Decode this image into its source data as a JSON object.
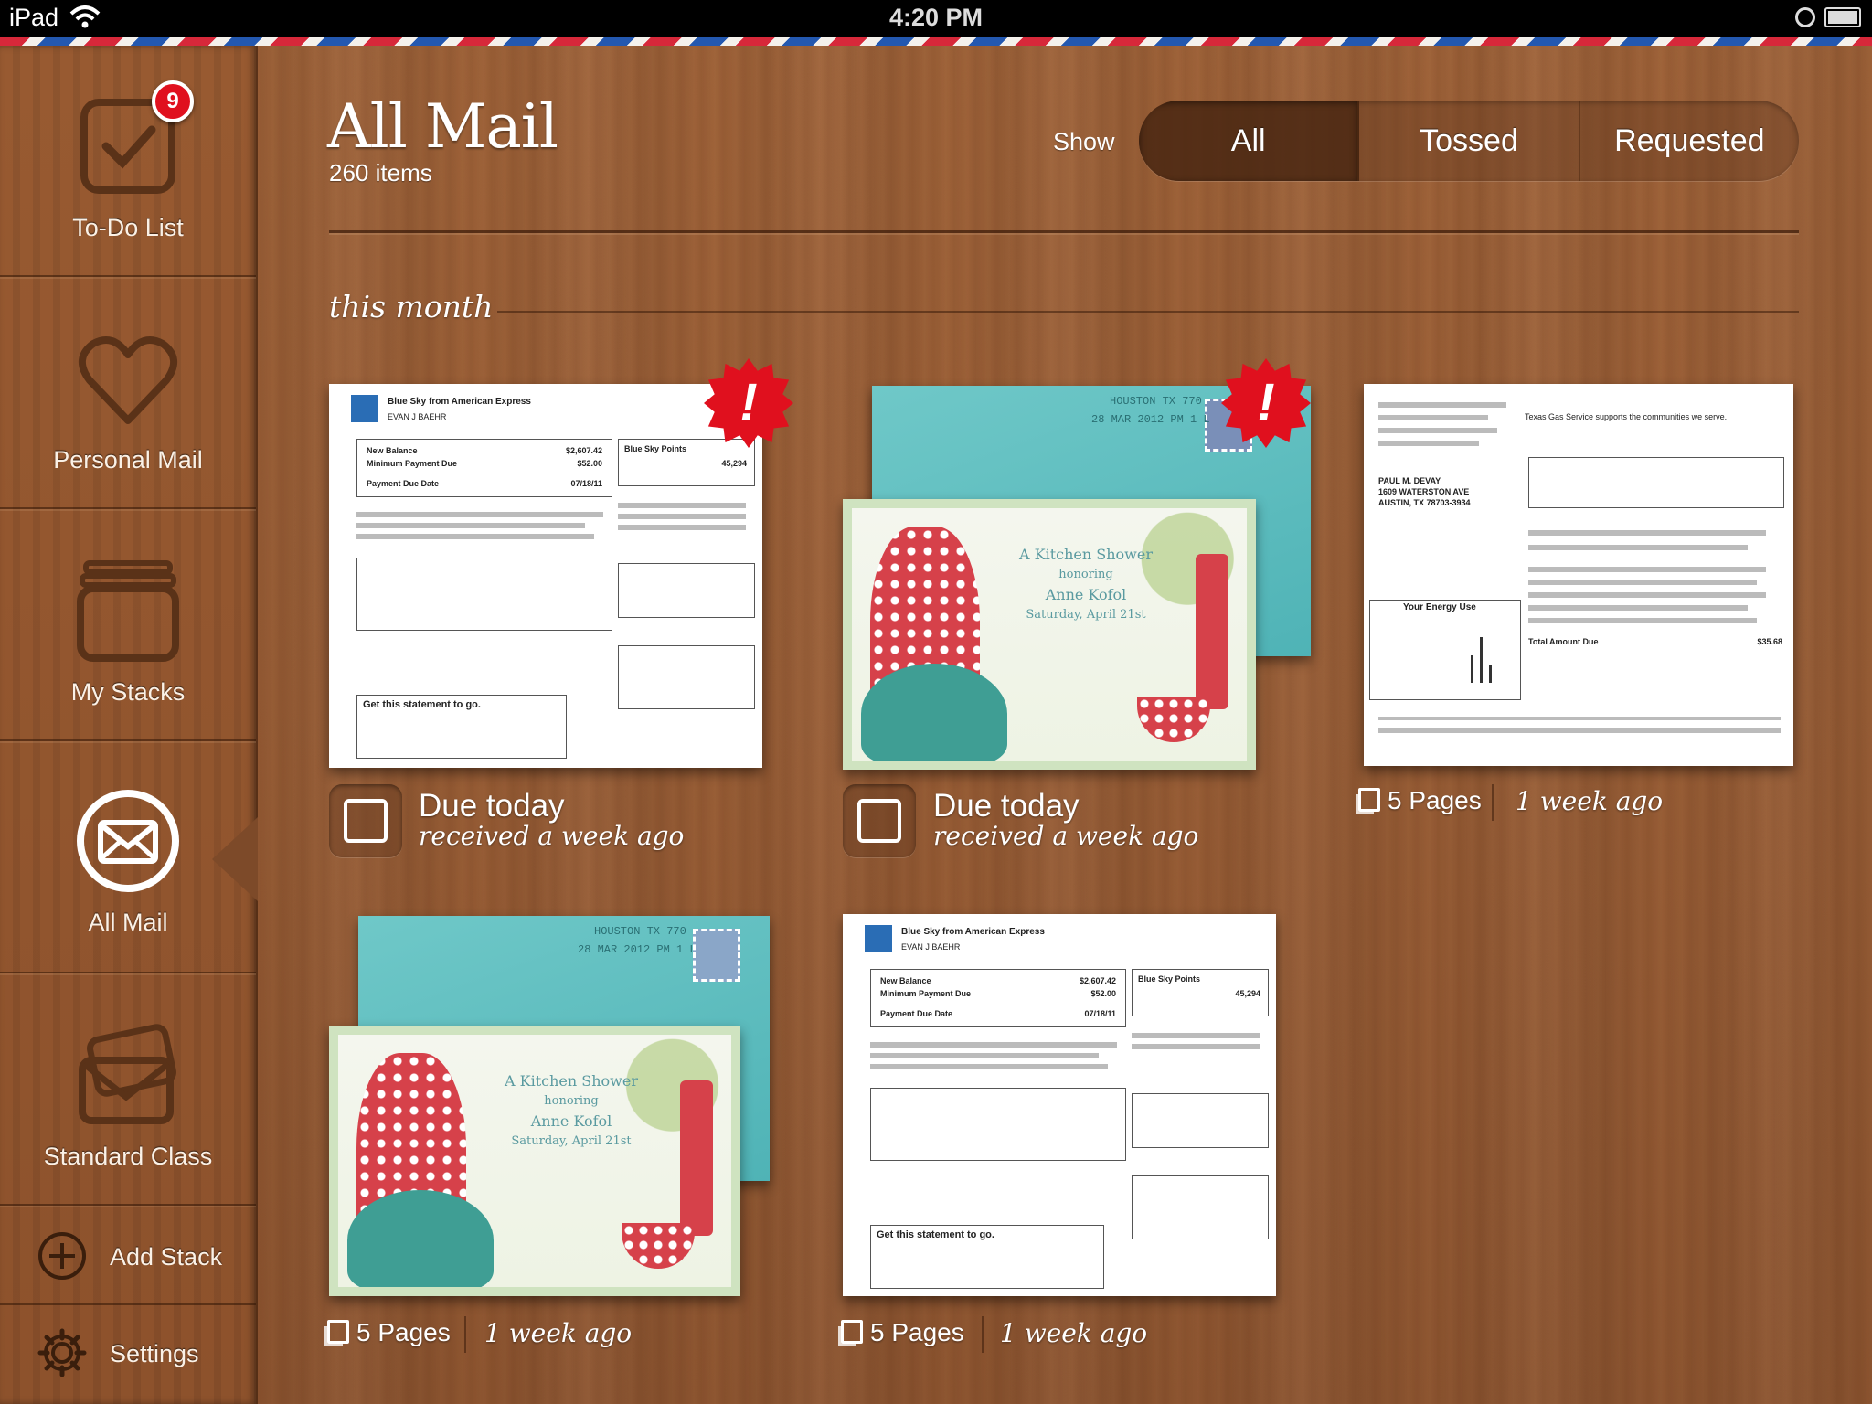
{
  "status_bar": {
    "device": "iPad",
    "time": "4:20 PM"
  },
  "sidebar": {
    "items": [
      {
        "label": "To-Do List",
        "badge": "9"
      },
      {
        "label": "Personal Mail"
      },
      {
        "label": "My Stacks"
      },
      {
        "label": "All Mail",
        "selected": true
      },
      {
        "label": "Standard Class"
      }
    ],
    "add_stack": "Add Stack",
    "settings": "Settings"
  },
  "header": {
    "title": "All Mail",
    "count": "260 items",
    "show_label": "Show",
    "filters": [
      "All",
      "Tossed",
      "Requested"
    ],
    "active_filter": "All"
  },
  "section": {
    "label": "this month"
  },
  "mail": [
    {
      "kind": "statement",
      "alert": "!",
      "status": "Due today",
      "received": "received a week ago",
      "doc": {
        "heading": "Blue Sky from American Express",
        "name": "EVAN J BAEHR",
        "new_balance": "New Balance",
        "new_balance_value": "$2,607.42",
        "min_due": "Minimum Payment Due",
        "min_due_value": "$52.00",
        "due_date": "Payment Due Date",
        "due_date_value": "07/18/11",
        "points": "Blue Sky Points",
        "points_value": "45,294",
        "get": "Get this statement to go."
      }
    },
    {
      "kind": "invitation",
      "alert": "!",
      "status": "Due today",
      "received": "received a week ago",
      "invite": {
        "title": "A Kitchen Shower",
        "honoring": "honoring",
        "name": "Anne Kofol",
        "date": "Saturday, April 21st"
      }
    },
    {
      "kind": "gas-bill",
      "pages": "5 Pages",
      "ago": "1 week ago",
      "doc": {
        "name": "PAUL M. DEVAY",
        "address": "1609 WATERSTON AVE",
        "city": "AUSTIN, TX 78703-3934",
        "company": "Texas Gas Service supports the communities we serve.",
        "energy": "Your Energy Use",
        "total": "Total Amount Due",
        "total_value": "$35.68"
      }
    },
    {
      "kind": "invitation",
      "pages": "5 Pages",
      "ago": "1 week ago",
      "invite": {
        "title": "A Kitchen Shower",
        "honoring": "honoring",
        "name": "Anne Kofol",
        "date": "Saturday, April 21st"
      }
    },
    {
      "kind": "statement",
      "pages": "5 Pages",
      "ago": "1 week ago",
      "doc": {
        "heading": "Blue Sky from American Express",
        "name": "EVAN J BAEHR",
        "new_balance": "New Balance",
        "new_balance_value": "$2,607.42",
        "min_due": "Minimum Payment Due",
        "min_due_value": "$52.00",
        "due_date": "Payment Due Date",
        "due_date_value": "07/18/11",
        "points": "Blue Sky Points",
        "points_value": "45,294",
        "get": "Get this statement to go."
      }
    }
  ],
  "colors": {
    "alert": "#e0101e",
    "envelope": "#5fbfc1",
    "wood": "#9a5f37"
  }
}
